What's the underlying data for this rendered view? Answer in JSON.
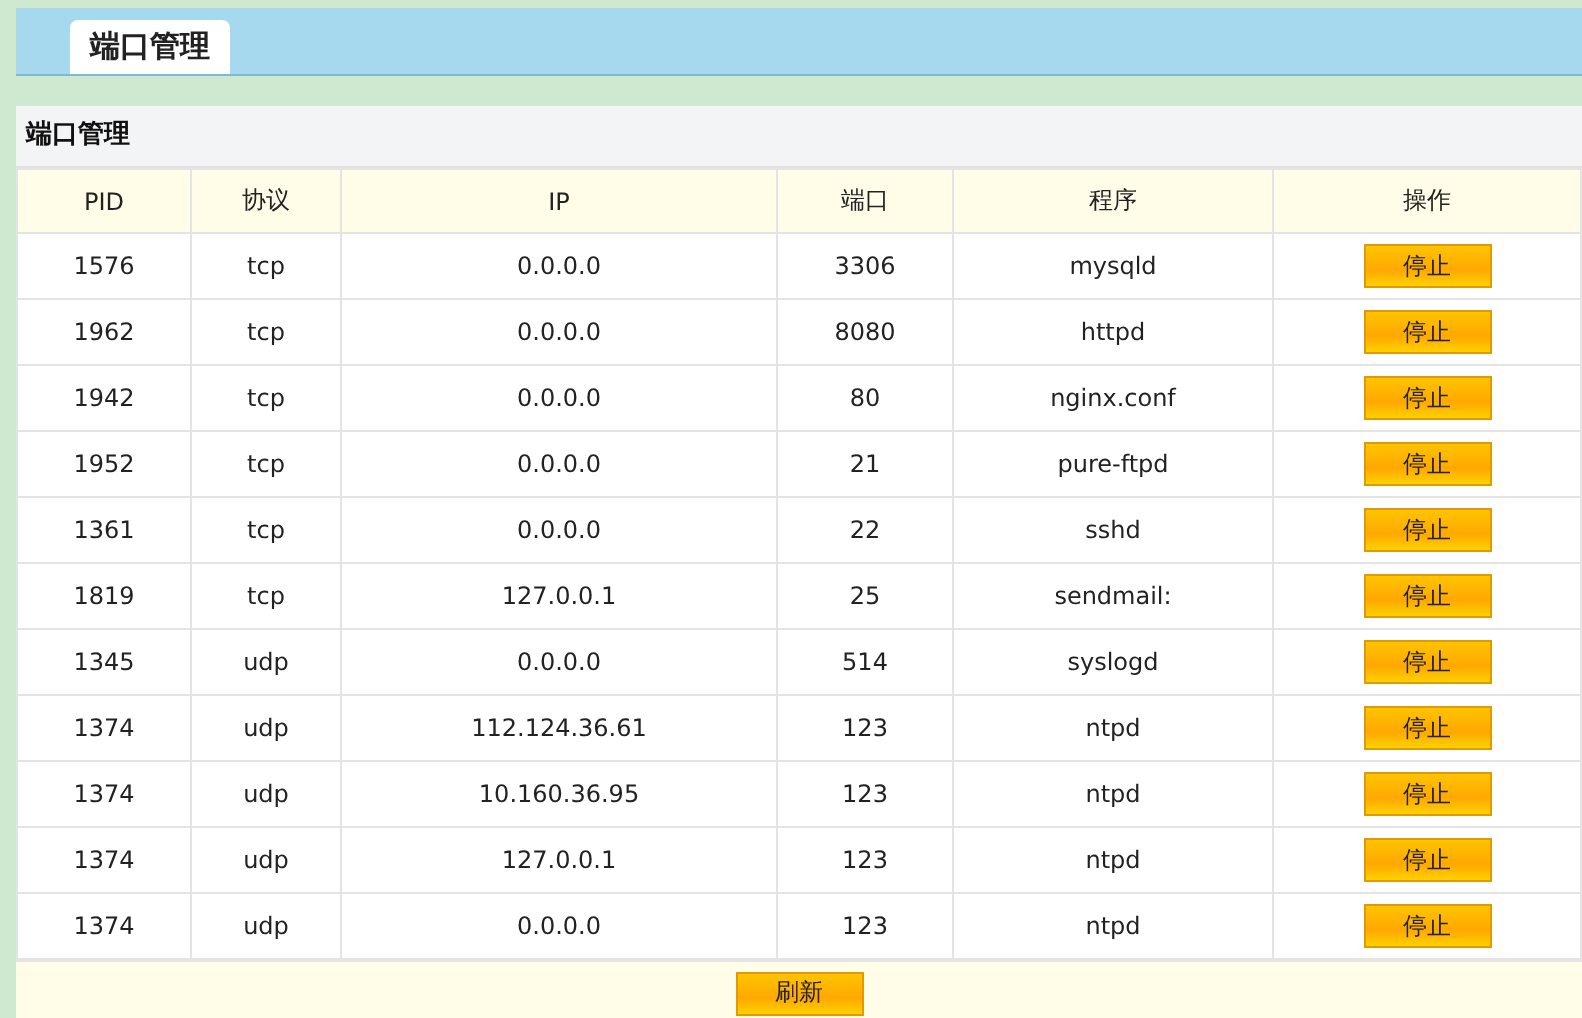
{
  "tabs": [
    {
      "label": "端口管理",
      "selected": true
    }
  ],
  "panel": {
    "title": "端口管理",
    "table": {
      "columns": [
        "PID",
        "协议",
        "IP",
        "端口",
        "程序",
        "操作"
      ],
      "rows": [
        {
          "cells": [
            "1576",
            "tcp",
            "0.0.0.0",
            "3306",
            "mysqld"
          ],
          "action": "停止"
        },
        {
          "cells": [
            "1962",
            "tcp",
            "0.0.0.0",
            "8080",
            "httpd"
          ],
          "action": "停止"
        },
        {
          "cells": [
            "1942",
            "tcp",
            "0.0.0.0",
            "80",
            "nginx.conf"
          ],
          "action": "停止"
        },
        {
          "cells": [
            "1952",
            "tcp",
            "0.0.0.0",
            "21",
            "pure-ftpd"
          ],
          "action": "停止"
        },
        {
          "cells": [
            "1361",
            "tcp",
            "0.0.0.0",
            "22",
            "sshd"
          ],
          "action": "停止"
        },
        {
          "cells": [
            "1819",
            "tcp",
            "127.0.0.1",
            "25",
            "sendmail:"
          ],
          "action": "停止"
        },
        {
          "cells": [
            "1345",
            "udp",
            "0.0.0.0",
            "514",
            "syslogd"
          ],
          "action": "停止"
        },
        {
          "cells": [
            "1374",
            "udp",
            "112.124.36.61",
            "123",
            "ntpd"
          ],
          "action": "停止"
        },
        {
          "cells": [
            "1374",
            "udp",
            "10.160.36.95",
            "123",
            "ntpd"
          ],
          "action": "停止"
        },
        {
          "cells": [
            "1374",
            "udp",
            "127.0.0.1",
            "123",
            "ntpd"
          ],
          "action": "停止"
        },
        {
          "cells": [
            "1374",
            "udp",
            "0.0.0.0",
            "123",
            "ntpd"
          ],
          "action": "停止"
        }
      ]
    },
    "refresh_button": "刷新"
  }
}
